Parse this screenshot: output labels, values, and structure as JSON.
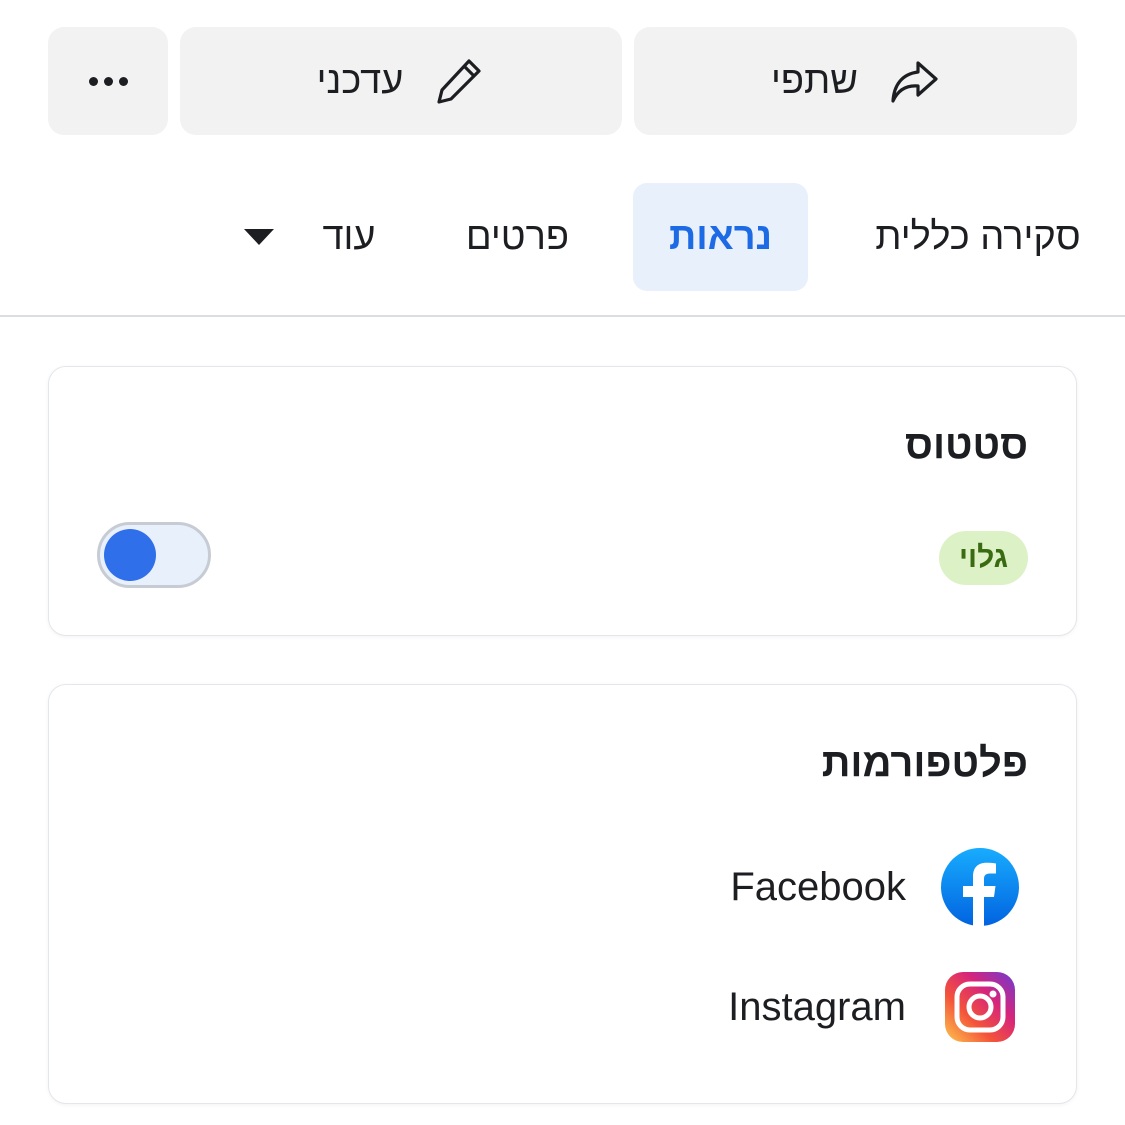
{
  "actions": {
    "share_label": "שתפי",
    "edit_label": "עדכני",
    "more_label": "",
    "share_icon": "share-arrow-icon",
    "edit_icon": "pencil-icon",
    "more_icon": "more-dots-icon"
  },
  "tabs": [
    {
      "label": "סקירה כללית",
      "active": false
    },
    {
      "label": "נראות",
      "active": true
    },
    {
      "label": "פרטים",
      "active": false
    },
    {
      "label": "עוד",
      "active": false,
      "icon": "caret-down-icon"
    }
  ],
  "status_card": {
    "title": "סטטוס",
    "badge": "גלוי",
    "toggle_on": true
  },
  "platforms_card": {
    "title": "פלטפורמות",
    "items": [
      {
        "name": "Facebook",
        "icon": "facebook-icon"
      },
      {
        "name": "Instagram",
        "icon": "instagram-icon"
      }
    ]
  },
  "colors": {
    "accent": "#1d6ae5",
    "active_tab_bg": "#e8f0fc",
    "badge_bg": "#dcf2c6",
    "badge_text": "#3a6b10",
    "toggle_knob": "#2f6fe9"
  }
}
